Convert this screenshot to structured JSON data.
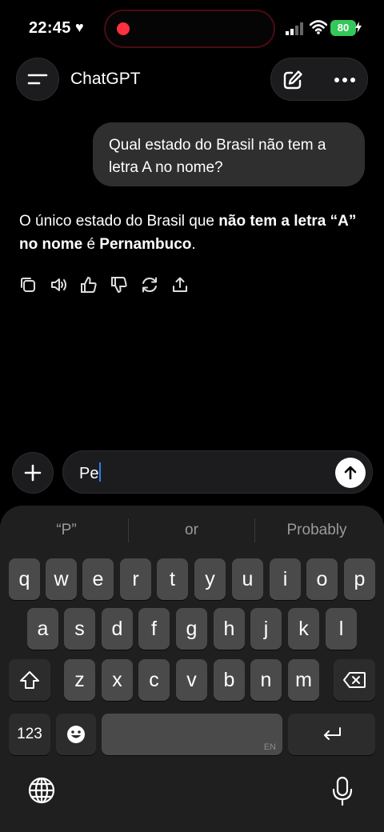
{
  "status_bar": {
    "time": "22:45",
    "battery": "80"
  },
  "header": {
    "title": "ChatGPT"
  },
  "chat": {
    "user_message": "Qual estado do Brasil não tem a letra A no nome?",
    "answer": {
      "p1": "O único estado do Brasil que ",
      "b1": "não tem a letra “A” no nome",
      "p2": " é ",
      "b2": "Pernambuco",
      "p3": "."
    }
  },
  "composer": {
    "text": "Pe"
  },
  "keyboard": {
    "suggestions": [
      "“P”",
      "or",
      "Probably"
    ],
    "row1": [
      "q",
      "w",
      "e",
      "r",
      "t",
      "y",
      "u",
      "i",
      "o",
      "p"
    ],
    "row2": [
      "a",
      "s",
      "d",
      "f",
      "g",
      "h",
      "j",
      "k",
      "l"
    ],
    "row3": [
      "z",
      "x",
      "c",
      "v",
      "b",
      "n",
      "m"
    ],
    "numbers_label": "123",
    "space_lang": "EN"
  },
  "icons": {
    "menu": "menu-icon",
    "edit": "new-chat-icon",
    "more": "more-icon",
    "copy": "copy-icon",
    "speaker": "read-aloud-icon",
    "like": "thumbs-up-icon",
    "dislike": "thumbs-down-icon",
    "regenerate": "regenerate-icon",
    "share": "share-icon",
    "send": "send-arrow-icon",
    "plus": "plus-icon"
  },
  "colors": {
    "battery": "#34c759",
    "recording": "#ff3040",
    "caret": "#2f7cf6"
  }
}
